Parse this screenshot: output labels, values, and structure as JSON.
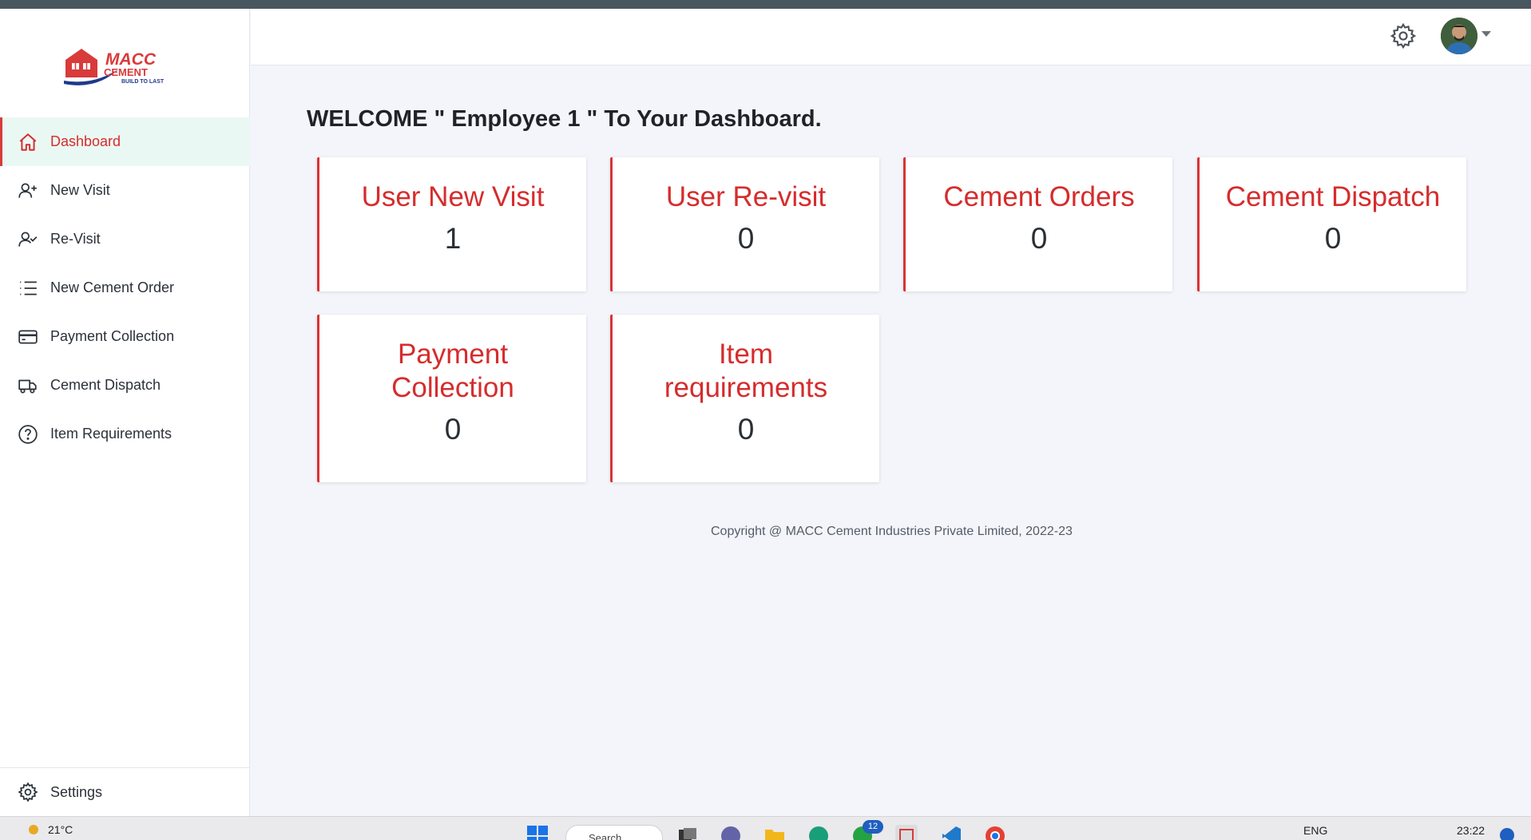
{
  "sidebar": {
    "logo": {
      "brand": "MACC",
      "sub": "CEMENT",
      "tagline": "BUILD TO LAST"
    },
    "items": [
      {
        "label": "Dashboard",
        "icon": "home-icon",
        "active": true
      },
      {
        "label": "New Visit",
        "icon": "user-plus-icon",
        "active": false
      },
      {
        "label": "Re-Visit",
        "icon": "user-check-icon",
        "active": false
      },
      {
        "label": "New Cement Order",
        "icon": "list-icon",
        "active": false
      },
      {
        "label": "Payment Collection",
        "icon": "credit-card-icon",
        "active": false
      },
      {
        "label": "Cement Dispatch",
        "icon": "truck-icon",
        "active": false
      },
      {
        "label": "Item Requirements",
        "icon": "help-circle-icon",
        "active": false
      }
    ],
    "settings_label": "Settings"
  },
  "header": {
    "settings_icon": "gear-icon",
    "avatar_icon": "user-avatar"
  },
  "main": {
    "welcome": "WELCOME \" Employee 1 \" To Your Dashboard.",
    "cards": [
      {
        "title": "User New Visit",
        "value": "1"
      },
      {
        "title": "User Re-visit",
        "value": "0"
      },
      {
        "title": "Cement Orders",
        "value": "0"
      },
      {
        "title": "Cement Dispatch",
        "value": "0"
      },
      {
        "title": "Payment Collection",
        "value": "0"
      },
      {
        "title": "Item requirements",
        "value": "0"
      }
    ],
    "copyright": "Copyright @ MACC Cement Industries Private Limited, 2022-23"
  },
  "taskbar": {
    "weather": "21°C",
    "search_label": "Search",
    "badge": "12",
    "language": "ENG",
    "time": "23:22"
  },
  "colors": {
    "accent": "#d62c2c",
    "active_bg": "#eaf8f3",
    "page_bg": "#f4f5fb"
  }
}
